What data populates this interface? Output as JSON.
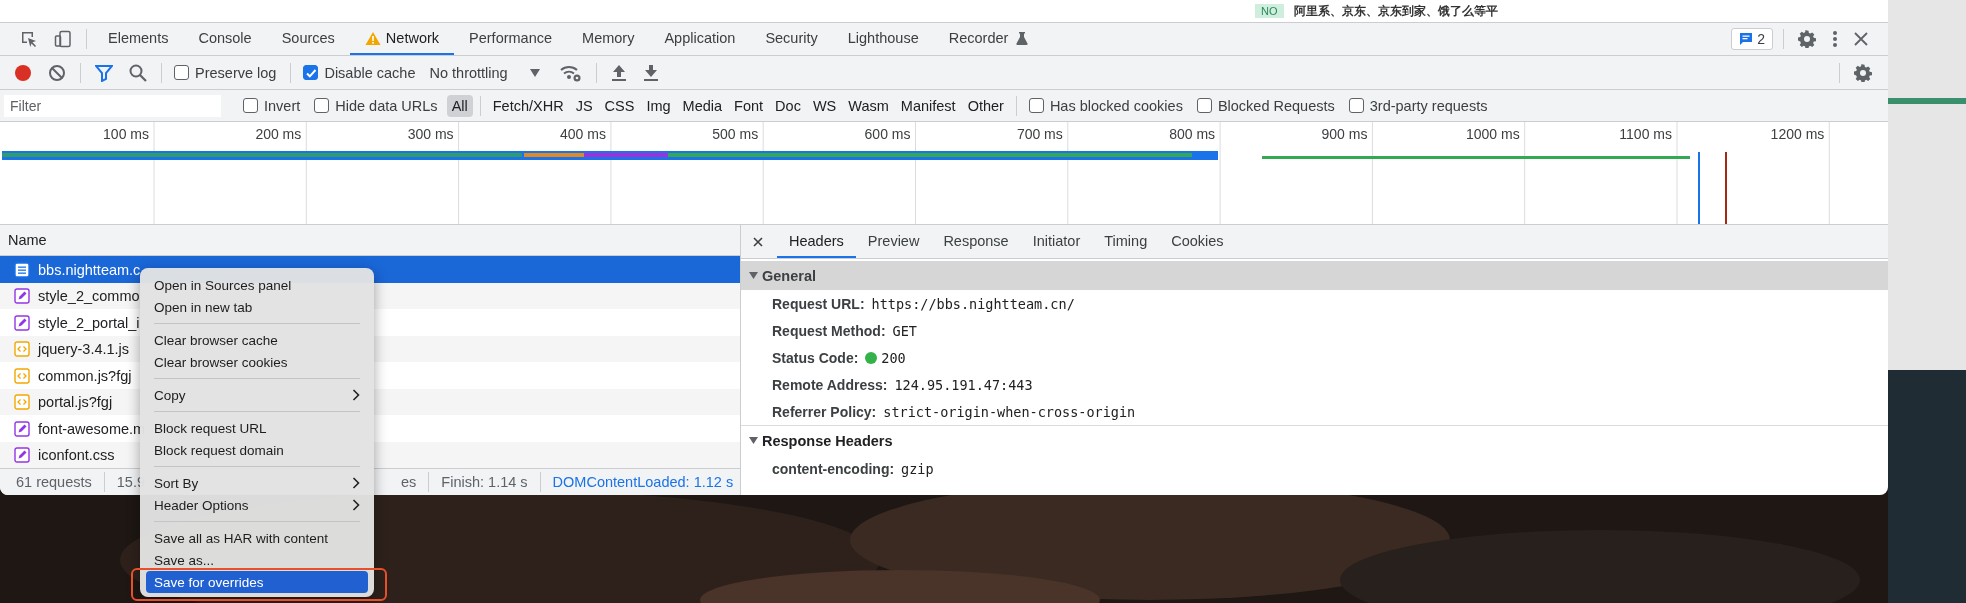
{
  "page_strip": {
    "badge": "NO",
    "text": "阿里系、京东、京东到家、饿了么等平"
  },
  "tabs": [
    {
      "label": "Elements",
      "selected": false
    },
    {
      "label": "Console",
      "selected": false
    },
    {
      "label": "Sources",
      "selected": false
    },
    {
      "label": "Network",
      "selected": true,
      "kind": "warning"
    },
    {
      "label": "Performance",
      "selected": false
    },
    {
      "label": "Memory",
      "selected": false
    },
    {
      "label": "Application",
      "selected": false
    },
    {
      "label": "Security",
      "selected": false
    },
    {
      "label": "Lighthouse",
      "selected": false
    },
    {
      "label": "Recorder",
      "selected": false,
      "kind": "experimental"
    }
  ],
  "issues_count": "2",
  "toolbar": {
    "recording": true,
    "filter_active": true,
    "checkboxes": [
      {
        "label": "Preserve log",
        "checked": false
      },
      {
        "label": "Disable cache",
        "checked": true
      }
    ],
    "throttling": "No throttling"
  },
  "filter": {
    "placeholder": "Filter",
    "checkboxes": [
      {
        "label": "Invert",
        "checked": false
      },
      {
        "label": "Hide data URLs",
        "checked": false
      }
    ],
    "types": [
      {
        "label": "All",
        "selected": true
      },
      {
        "label": "Fetch/XHR",
        "selected": false
      },
      {
        "label": "JS",
        "selected": false
      },
      {
        "label": "CSS",
        "selected": false
      },
      {
        "label": "Img",
        "selected": false
      },
      {
        "label": "Media",
        "selected": false
      },
      {
        "label": "Font",
        "selected": false
      },
      {
        "label": "Doc",
        "selected": false
      },
      {
        "label": "WS",
        "selected": false
      },
      {
        "label": "Wasm",
        "selected": false
      },
      {
        "label": "Manifest",
        "selected": false
      },
      {
        "label": "Other",
        "selected": false
      }
    ],
    "more_checkboxes": [
      {
        "label": "Has blocked cookies",
        "checked": false
      },
      {
        "label": "Blocked Requests",
        "checked": false
      },
      {
        "label": "3rd-party requests",
        "checked": false
      }
    ]
  },
  "timeline": {
    "ticks": [
      "100 ms",
      "200 ms",
      "300 ms",
      "400 ms",
      "500 ms",
      "600 ms",
      "700 ms",
      "800 ms",
      "900 ms",
      "1000 ms",
      "1100 ms",
      "1200 ms"
    ]
  },
  "requests": {
    "column": "Name",
    "rows": [
      {
        "name": "bbs.nightteam.c",
        "kind": "document",
        "selected": true
      },
      {
        "name": "style_2_commo",
        "kind": "stylesheet",
        "selected": false
      },
      {
        "name": "style_2_portal_i",
        "kind": "stylesheet",
        "selected": false
      },
      {
        "name": "jquery-3.4.1.js",
        "kind": "script",
        "selected": false
      },
      {
        "name": "common.js?fgj",
        "kind": "script",
        "selected": false
      },
      {
        "name": "portal.js?fgj",
        "kind": "script",
        "selected": false
      },
      {
        "name": "font-awesome.m",
        "kind": "stylesheet",
        "selected": false
      },
      {
        "name": "iconfont.css",
        "kind": "stylesheet",
        "selected": false
      }
    ]
  },
  "status_bar": [
    {
      "text": "61 requests",
      "kind": "plain"
    },
    {
      "text": "15.9",
      "kind": "plain"
    },
    {
      "text": "es",
      "kind": "plain"
    },
    {
      "text": "Finish: 1.14 s",
      "kind": "plain"
    },
    {
      "text": "DOMContentLoaded: 1.12 s",
      "kind": "link"
    }
  ],
  "details": {
    "tabs": [
      {
        "label": "Headers",
        "selected": true
      },
      {
        "label": "Preview",
        "selected": false
      },
      {
        "label": "Response",
        "selected": false
      },
      {
        "label": "Initiator",
        "selected": false
      },
      {
        "label": "Timing",
        "selected": false
      },
      {
        "label": "Cookies",
        "selected": false
      }
    ],
    "sections": [
      {
        "title": "General",
        "expanded": true,
        "rows": [
          {
            "label": "Request URL:",
            "value": "https://bbs.nightteam.cn/"
          },
          {
            "label": "Request Method:",
            "value": "GET"
          },
          {
            "label": "Status Code:",
            "value": "200",
            "kind": "status"
          },
          {
            "label": "Remote Address:",
            "value": "124.95.191.47:443"
          },
          {
            "label": "Referrer Policy:",
            "value": "strict-origin-when-cross-origin"
          }
        ]
      },
      {
        "title": "Response Headers",
        "expanded": true,
        "rows": [
          {
            "label": "content-encoding:",
            "value": "gzip"
          }
        ]
      }
    ]
  },
  "context_menu": {
    "groups": [
      [
        {
          "label": "Open in Sources panel",
          "submenu": false,
          "selected": false
        },
        {
          "label": "Open in new tab",
          "submenu": false,
          "selected": false
        }
      ],
      [
        {
          "label": "Clear browser cache",
          "submenu": false,
          "selected": false
        },
        {
          "label": "Clear browser cookies",
          "submenu": false,
          "selected": false
        }
      ],
      [
        {
          "label": "Copy",
          "submenu": true,
          "selected": false
        }
      ],
      [
        {
          "label": "Block request URL",
          "submenu": false,
          "selected": false
        },
        {
          "label": "Block request domain",
          "submenu": false,
          "selected": false
        }
      ],
      [
        {
          "label": "Sort By",
          "submenu": true,
          "selected": false
        },
        {
          "label": "Header Options",
          "submenu": true,
          "selected": false
        }
      ],
      [
        {
          "label": "Save all as HAR with content",
          "submenu": false,
          "selected": false
        },
        {
          "label": "Save as...",
          "submenu": false,
          "selected": false
        },
        {
          "label": "Save for overrides",
          "submenu": false,
          "selected": true
        }
      ]
    ]
  }
}
